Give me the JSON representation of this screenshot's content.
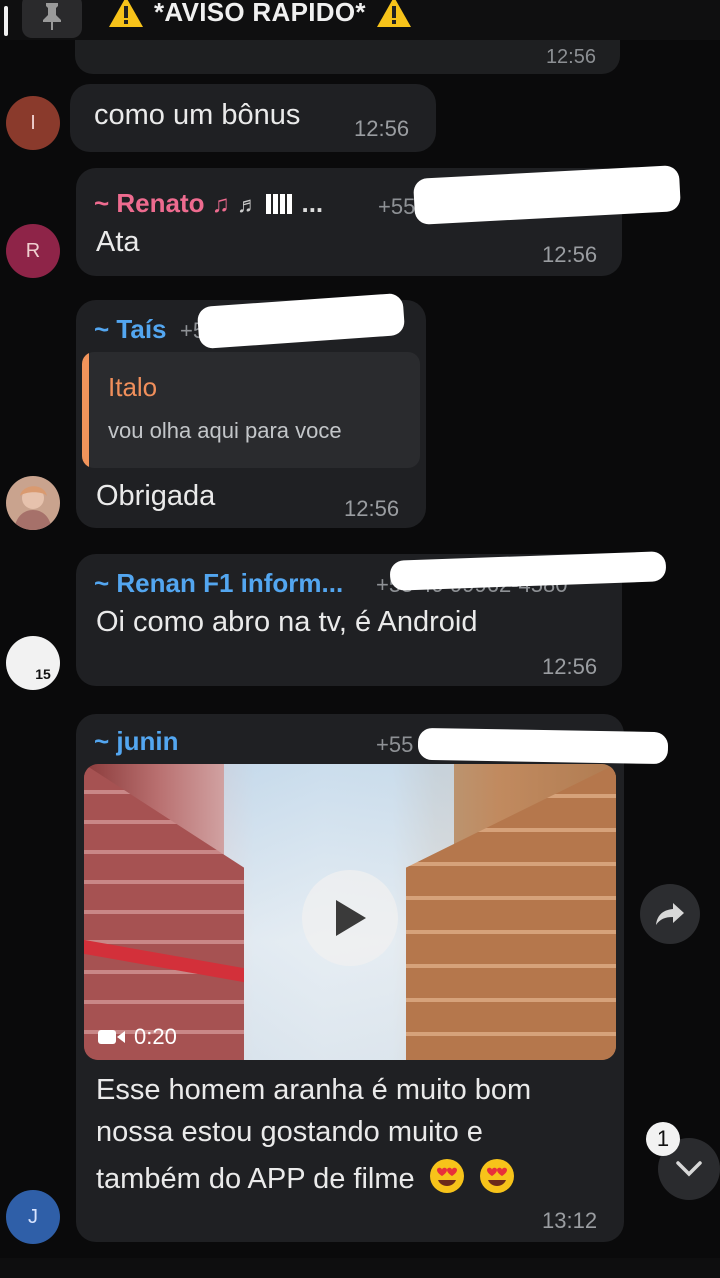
{
  "header": {
    "title": "*AVISO RAPIDO*"
  },
  "previous": {
    "time": "12:56"
  },
  "messages": [
    {
      "avatar_letter": "I",
      "text": "como um bônus",
      "time": "12:56"
    },
    {
      "avatar_letter": "R",
      "sender": "~ Renato",
      "sender_extra": "...",
      "phone": "+55",
      "text": "Ata",
      "time": "12:56"
    },
    {
      "sender": "~ Taís",
      "phone": "+55",
      "quote_name": "Italo",
      "quote_text": "vou olha aqui para voce",
      "text": "Obrigada",
      "time": "12:56"
    },
    {
      "sender": "~ Renan F1 inform...",
      "phone": "+55 49 99962-4580",
      "text": "Oi como abro na tv, é Android",
      "time": "12:56",
      "avatar_text": "15"
    },
    {
      "avatar_letter": "J",
      "sender": "~ junin",
      "phone": "+55",
      "video_duration": "0:20",
      "text_lines": [
        "Esse homem aranha  é muito bom",
        "nossa estou gostando  muito e",
        "também  do APP de filme"
      ],
      "time": "13:12"
    }
  ],
  "unread_badge": "1",
  "colors": {
    "renato": "#ee6b8f",
    "tais": "#53a6f0",
    "renan": "#53a6f0",
    "junin": "#53a6f0",
    "quote": "#f08f5b"
  }
}
